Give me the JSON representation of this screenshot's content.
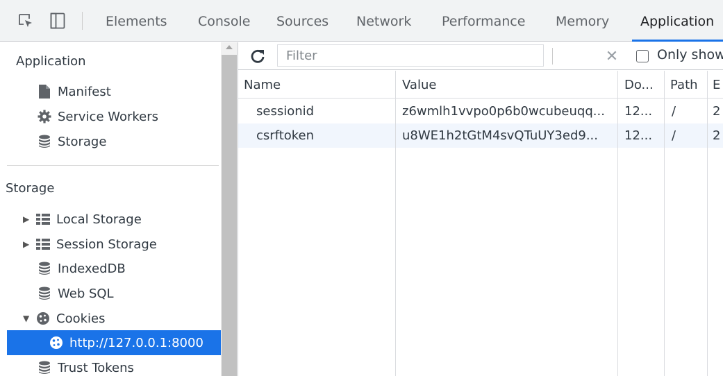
{
  "tabs": [
    "Elements",
    "Console",
    "Sources",
    "Network",
    "Performance",
    "Memory",
    "Application"
  ],
  "active_tab": "Application",
  "sidebar": {
    "application_title": "Application",
    "application_items": [
      {
        "label": "Manifest",
        "icon": "file-icon"
      },
      {
        "label": "Service Workers",
        "icon": "gear-icon"
      },
      {
        "label": "Storage",
        "icon": "database-icon"
      }
    ],
    "storage_title": "Storage",
    "storage_items": [
      {
        "label": "Local Storage",
        "icon": "grid-icon",
        "expander": "collapsed"
      },
      {
        "label": "Session Storage",
        "icon": "grid-icon",
        "expander": "collapsed"
      },
      {
        "label": "IndexedDB",
        "icon": "database-icon"
      },
      {
        "label": "Web SQL",
        "icon": "database-icon"
      },
      {
        "label": "Cookies",
        "icon": "cookie-icon",
        "expander": "expanded"
      },
      {
        "label": "http://127.0.0.1:8000",
        "icon": "cookie-icon",
        "selected": true
      },
      {
        "label": "Trust Tokens",
        "icon": "database-icon"
      }
    ]
  },
  "toolbar": {
    "filter_placeholder": "Filter",
    "only_show_label": "Only show"
  },
  "table": {
    "columns": [
      "Name",
      "Value",
      "Do...",
      "Path",
      "E"
    ],
    "rows": [
      [
        "sessionid",
        "z6wmlh1vvpo0p6b0wcubeuqq...",
        "12...",
        "/",
        "2"
      ],
      [
        "csrftoken",
        "u8WE1h2tGtM4svQTuUY3ed9...",
        "12...",
        "/",
        "2"
      ]
    ]
  },
  "colors": {
    "accent": "#1a73e8",
    "selected_row": "#f1f6fd"
  }
}
